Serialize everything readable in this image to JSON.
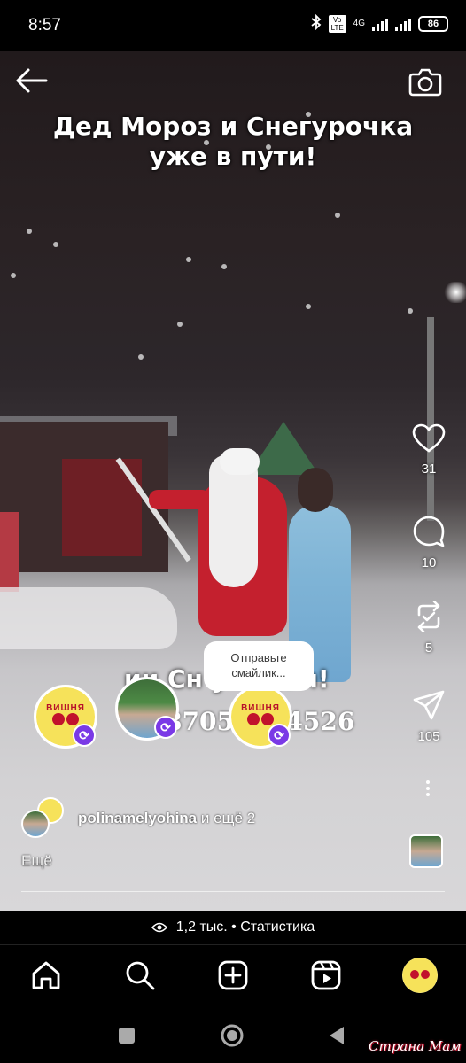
{
  "status_bar": {
    "time": "8:57",
    "network_label": "4G",
    "volte_label": "Vo LTE",
    "battery": "86"
  },
  "video": {
    "title_line1": "Дед Мороз и Снегурочка",
    "title_line2": "уже в пути!",
    "subtitle": "ии Сн   у в дом!",
    "phone": "87053294526"
  },
  "actions": {
    "likes": "31",
    "comments": "10",
    "reposts": "5",
    "shares": "105"
  },
  "reaction_tooltip": {
    "line1": "Отправьте",
    "line2": "смайлик..."
  },
  "reaction_logo_text": "ВИШНЯ",
  "liked_by": {
    "user": "polinamelyohina",
    "rest": "и ещё 2"
  },
  "more_label": "Ещё",
  "stats": {
    "text": "1,2 тыс. • Статистика"
  },
  "watermark": "Страна Мам",
  "colors": {
    "background": "#000000",
    "accent_purple": "#7a39e6",
    "brand_cherry": "#c1122c",
    "brand_yellow": "#f6e25a"
  },
  "icons": [
    "back-arrow-icon",
    "camera-icon",
    "heart-icon",
    "comment-icon",
    "repost-icon",
    "send-icon",
    "more-icon",
    "home-icon",
    "search-icon",
    "create-icon",
    "reels-icon",
    "recents-icon",
    "home-circle-icon",
    "back-triangle-icon"
  ]
}
